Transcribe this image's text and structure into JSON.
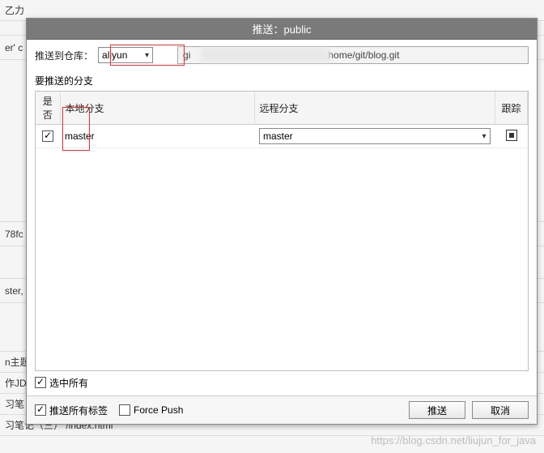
{
  "background": {
    "items": [
      "乙力",
      "",
      "er' c",
      "",
      "78fc",
      "",
      "ster,",
      "",
      "n主题",
      "作JD",
      "习笔（一） /index.html",
      "习笔记（三） /index.html"
    ]
  },
  "dialog": {
    "title": "推送：public",
    "repo_label": "推送到仓库：",
    "repo_select": "aliyun",
    "url_prefix": "gi",
    "url_suffix": "home/git/blog.git",
    "branches_group": "要推送的分支",
    "headers": {
      "check": "是否",
      "local": "本地分支",
      "remote": "远程分支",
      "track": "跟踪"
    },
    "rows": [
      {
        "checked": true,
        "local": "master",
        "remote": "master"
      }
    ],
    "select_all": "选中所有",
    "push_tags": "推送所有标签",
    "force_push": "Force Push",
    "ok": "推送",
    "cancel": "取消"
  },
  "watermark": "https://blog.csdn.net/liujun_for_java"
}
